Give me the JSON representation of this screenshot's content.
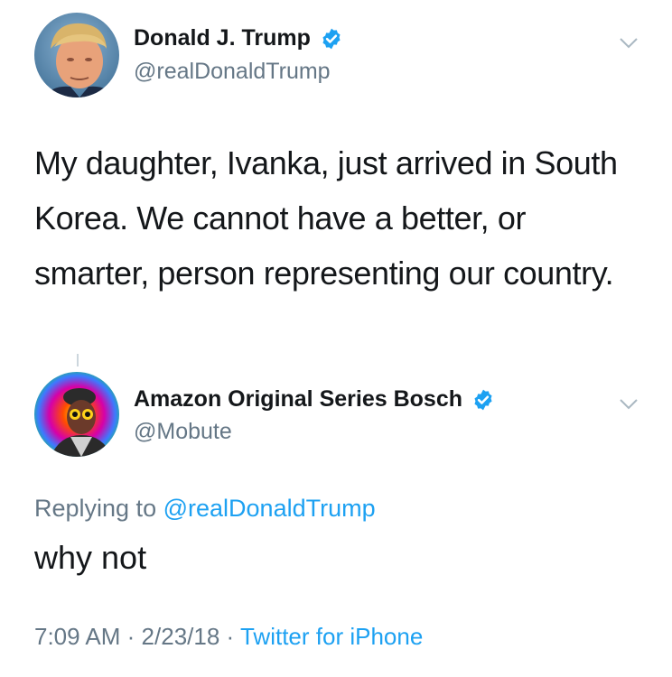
{
  "tweet": {
    "author_name": "Donald J. Trump",
    "author_handle": "@realDonaldTrump",
    "verified": true,
    "text": "My daughter, Ivanka, just arrived in South Korea. We cannot have a better, or smarter, person representing our country."
  },
  "reply": {
    "author_name": "Amazon Original Series Bosch",
    "author_handle": "@Mobute",
    "verified": true,
    "replying_to_prefix": "Replying to",
    "replying_to_handle": "@realDonaldTrump",
    "text": "why not",
    "timestamp_time": "7:09 AM",
    "timestamp_date": "2/23/18",
    "separator": "·",
    "source": "Twitter for iPhone"
  },
  "colors": {
    "text": "#14171a",
    "secondary": "#657786",
    "link": "#1da1f2",
    "verified_badge": "#1da1f2"
  },
  "icons": {
    "verified": "verified-badge-icon",
    "caret": "chevron-down-icon"
  }
}
